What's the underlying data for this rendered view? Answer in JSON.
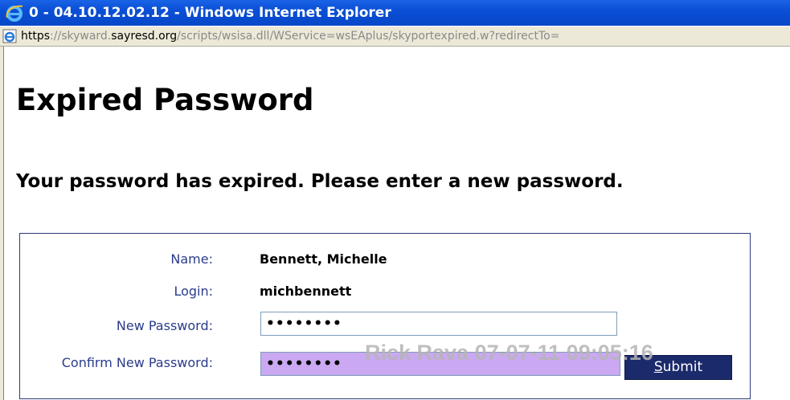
{
  "window": {
    "title": "0 - 04.10.12.02.12 - Windows Internet Explorer"
  },
  "address": {
    "protocol": "https",
    "sep": "://skyward.",
    "host": "sayresd.org",
    "path": "/scripts/wsisa.dll/WService=wsEAplus/skyportexpired.w?redirectTo="
  },
  "page": {
    "title": "Expired Password",
    "message": "Your password has expired. Please enter a new password."
  },
  "form": {
    "name_label": "Name:",
    "name_value": "Bennett, Michelle",
    "login_label": "Login:",
    "login_value": "michbennett",
    "new_password_label": "New Password:",
    "new_password_value": "••••••••",
    "confirm_password_label": "Confirm New Password:",
    "confirm_password_value": "••••••••",
    "submit_first": "S",
    "submit_rest": "ubmit"
  },
  "watermark": "Rick Rava 07-07-11 09:05:16",
  "colors": {
    "titlebar": "#0a4fd6",
    "label": "#2b3c8c",
    "submit_bg": "#1b2a6b",
    "confirm_highlight": "#cba8f2"
  }
}
